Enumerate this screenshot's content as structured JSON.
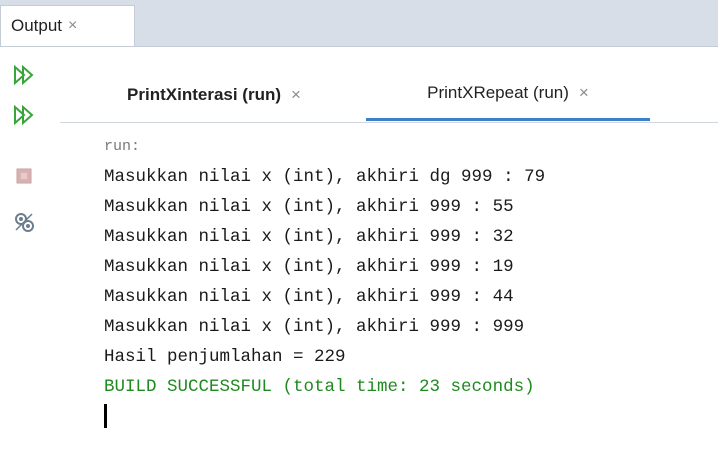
{
  "window_tab": {
    "label": "Output",
    "close": "×"
  },
  "toolbar": {
    "icons": [
      "rerun-icon",
      "rerun-with-params-icon",
      "stop-icon",
      "settings-icon"
    ]
  },
  "run_tabs": [
    {
      "label": "PrintXinterasi (run)",
      "close": "×"
    },
    {
      "label": "PrintXRepeat (run)",
      "close": "×"
    }
  ],
  "console": {
    "lines": [
      "run:",
      "Masukkan nilai x (int), akhiri dg 999 : 79",
      "Masukkan nilai x (int), akhiri 999 : 55",
      "Masukkan nilai x (int), akhiri 999 : 32",
      "Masukkan nilai x (int), akhiri 999 : 19",
      "Masukkan nilai x (int), akhiri 999 : 44",
      "Masukkan nilai x (int), akhiri 999 : 999",
      "Hasil penjumlahan = 229",
      "BUILD SUCCESSFUL (total time: 23 seconds)"
    ]
  },
  "colors": {
    "tab_bar": "#d7dee8",
    "active_underline": "#3b80c8",
    "success_text": "#1f8a1f",
    "rerun_icon": "#3aa53a"
  }
}
